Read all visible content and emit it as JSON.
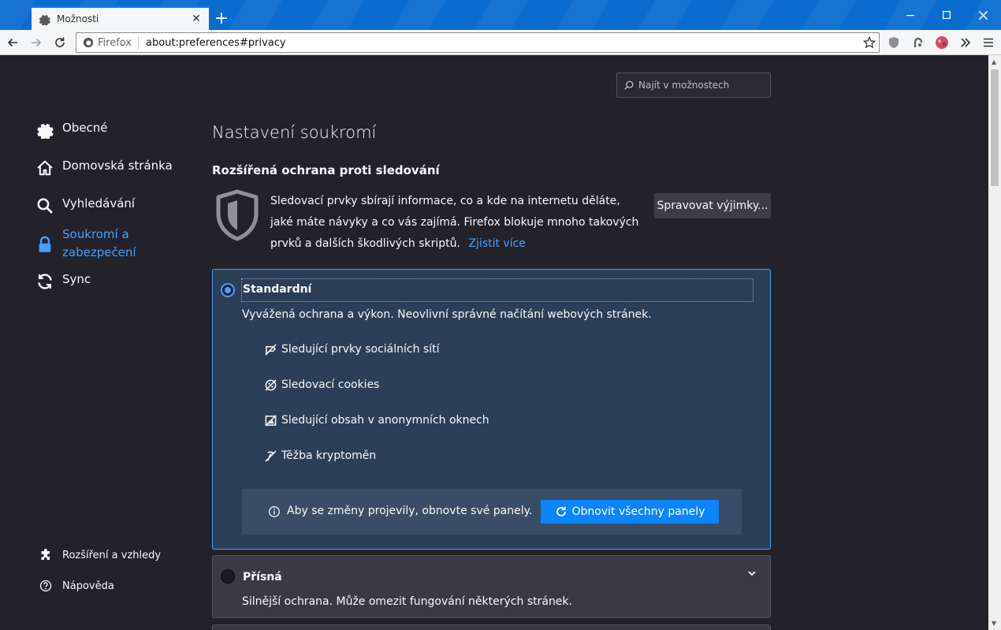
{
  "window": {
    "tab_title": "Možnosti",
    "new_tab_symbol": "+",
    "close_tab_symbol": "✕"
  },
  "navbar": {
    "identity_label": "Firefox",
    "url": "about:preferences#privacy"
  },
  "search": {
    "placeholder": "Najít v možnostech"
  },
  "sidebar": {
    "items": [
      {
        "label": "Obecné",
        "icon": "gear-icon"
      },
      {
        "label": "Domovská stránka",
        "icon": "home-icon"
      },
      {
        "label": "Vyhledávání",
        "icon": "search-icon"
      },
      {
        "label": "Soukromí a zabezpečení",
        "icon": "lock-icon",
        "selected": true
      },
      {
        "label": "Sync",
        "icon": "sync-icon"
      }
    ],
    "footer": [
      {
        "label": "Rozšíření a vzhledy",
        "icon": "puzzle-icon"
      },
      {
        "label": "Nápověda",
        "icon": "help-icon"
      }
    ]
  },
  "main": {
    "title": "Nastavení soukromí",
    "etp": {
      "heading": "Rozšířená ochrana proti sledování",
      "description": "Sledovací prvky sbírají informace, co a kde na internetu děláte, jaké máte návyky a co vás zajímá. Firefox blokuje mnoho takových prvků a dalších škodlivých skriptů.",
      "learn_more": "Zjistit více",
      "exceptions_button": "Spravovat výjimky..."
    },
    "standard": {
      "label": "Standardní",
      "description": "Vyvážená ochrana a výkon. Neovlivní správné načítání webových stránek.",
      "features": [
        {
          "label": "Sledující prvky sociálních sítí",
          "icon": "social-tracker-icon"
        },
        {
          "label": "Sledovací cookies",
          "icon": "cookie-icon"
        },
        {
          "label": "Sledující obsah v anonymních oknech",
          "icon": "tracking-content-icon"
        },
        {
          "label": "Těžba kryptoměn",
          "icon": "cryptominer-icon"
        }
      ],
      "reload_notice": "Aby se změny projevily, obnovte své panely.",
      "reload_button": "Obnovit všechny panely"
    },
    "strict": {
      "label": "Přísná",
      "description": "Silnější ochrana. Může omezit fungování některých stránek."
    }
  },
  "colors": {
    "accent": "#0a84ff",
    "link": "#45a1ff",
    "background": "#23222b",
    "selected_card": "#2b3f57"
  }
}
